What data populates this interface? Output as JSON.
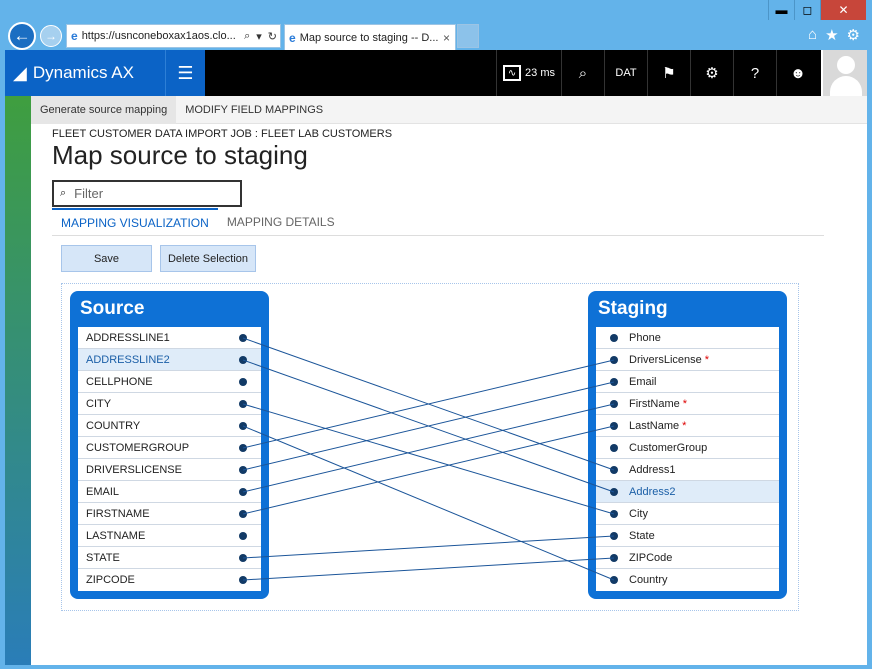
{
  "browser": {
    "url": "https://usnconeboxax1aos.clo...",
    "tab_title": "Map source to staging -- D...",
    "tab_close": "×",
    "back": "←",
    "forward": "→",
    "icons_right": [
      "home-icon",
      "star-icon",
      "gear-icon"
    ]
  },
  "window_controls": {
    "minimize": "▬",
    "maximize": "◻",
    "close": "✕"
  },
  "app": {
    "brand": "Dynamics AX",
    "perf_label": "23 ms",
    "company": "DAT"
  },
  "action_pane": {
    "tabs": [
      "Generate source mapping",
      "MODIFY FIELD MAPPINGS"
    ]
  },
  "page": {
    "job_title": "FLEET CUSTOMER DATA IMPORT JOB : FLEET LAB CUSTOMERS",
    "title": "Map source to staging",
    "filter_placeholder": "Filter",
    "subtabs": [
      "MAPPING VISUALIZATION",
      "MAPPING DETAILS"
    ],
    "save_label": "Save",
    "delete_label": "Delete Selection"
  },
  "source": {
    "title": "Source",
    "fields": [
      "ADDRESSLINE1",
      "ADDRESSLINE2",
      "CELLPHONE",
      "CITY",
      "COUNTRY",
      "CUSTOMERGROUP",
      "DRIVERSLICENSE",
      "EMAIL",
      "FIRSTNAME",
      "LASTNAME",
      "STATE",
      "ZIPCODE"
    ],
    "selected_index": 1
  },
  "staging": {
    "title": "Staging",
    "fields": [
      {
        "name": "Phone",
        "required": false
      },
      {
        "name": "DriversLicense",
        "required": true
      },
      {
        "name": "Email",
        "required": false
      },
      {
        "name": "FirstName",
        "required": true
      },
      {
        "name": "LastName",
        "required": true
      },
      {
        "name": "CustomerGroup",
        "required": false
      },
      {
        "name": "Address1",
        "required": false
      },
      {
        "name": "Address2",
        "required": false
      },
      {
        "name": "City",
        "required": false
      },
      {
        "name": "State",
        "required": false
      },
      {
        "name": "ZIPCode",
        "required": false
      },
      {
        "name": "Country",
        "required": false
      }
    ],
    "selected_index": 7
  },
  "mappings": [
    {
      "source": "ADDRESSLINE1",
      "staging": "Address1"
    },
    {
      "source": "ADDRESSLINE2",
      "staging": "Address2"
    },
    {
      "source": "CITY",
      "staging": "City"
    },
    {
      "source": "COUNTRY",
      "staging": "Country"
    },
    {
      "source": "CUSTOMERGROUP",
      "staging": "DriversLicense"
    },
    {
      "source": "DRIVERSLICENSE",
      "staging": "Email"
    },
    {
      "source": "EMAIL",
      "staging": "FirstName"
    },
    {
      "source": "FIRSTNAME",
      "staging": "LastName"
    },
    {
      "source": "STATE",
      "staging": "State"
    },
    {
      "source": "ZIPCODE",
      "staging": "ZIPCode"
    }
  ],
  "colors": {
    "brand": "#0b63c6",
    "box": "#0e71d6",
    "link": "#1b5599"
  }
}
